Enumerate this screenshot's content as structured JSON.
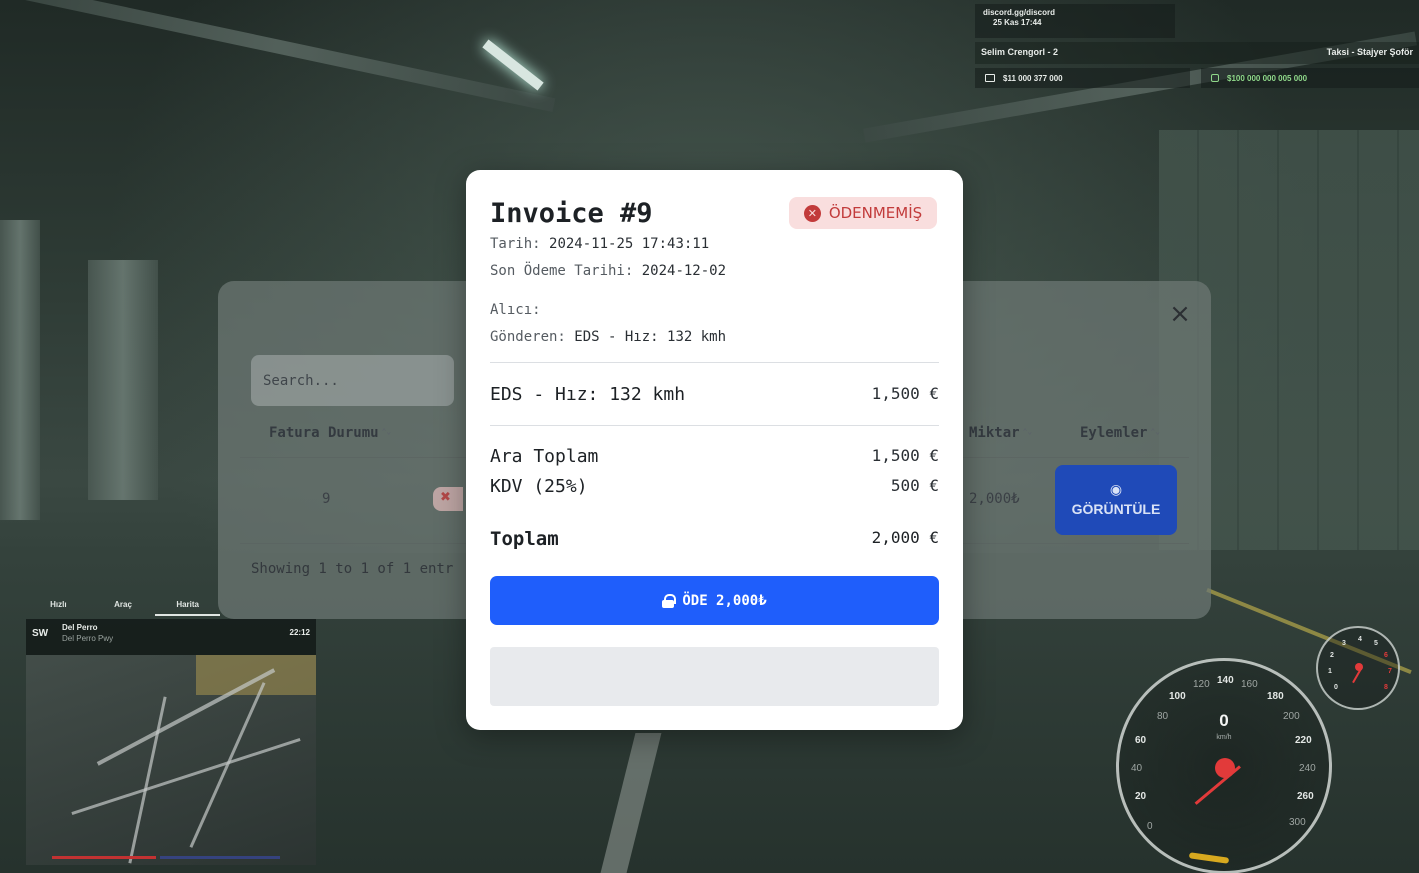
{
  "hud": {
    "discord_line1": "discord.gg/discord",
    "discord_line2": "25 Kas 17:44",
    "player_name": "Selim Crengorl - 2",
    "job": "Taksi - Stajyer Şoför",
    "cash": "$11 000 377 000",
    "bank": "$100 000 000 005 000"
  },
  "table_panel": {
    "close_icon": "×",
    "search_placeholder": "Search...",
    "headers": {
      "status": "Fatura Durumu",
      "amount": "Miktar",
      "actions": "Eylemler"
    },
    "sort_icon": "⌃⌄",
    "row": {
      "id": "9",
      "amount": "2,000₺",
      "view_label": "GÖRÜNTÜLE"
    },
    "footer_text": "Showing 1 to 1 of 1 entr"
  },
  "invoice": {
    "title": "Invoice #9",
    "status_badge": "ÖDENMEMİŞ",
    "date_label": "Tarih:",
    "date_value": "2024-11-25 17:43:11",
    "due_label": "Son Ödeme Tarihi:",
    "due_value": "2024-12-02",
    "recipient_label": "Alıcı:",
    "recipient_value": "",
    "sender_label": "Gönderen:",
    "sender_value": "EDS - Hız: 132 kmh",
    "items": [
      {
        "description": "EDS - Hız: 132 kmh",
        "amount": "1,500 €"
      }
    ],
    "subtotal_label": "Ara Toplam",
    "subtotal_value": "1,500 €",
    "tax_label": "KDV (25%)",
    "tax_value": "500 €",
    "total_label": "Toplam",
    "total_value": "2,000 €",
    "pay_button": "ÖDE 2,000₺"
  },
  "minimap": {
    "tabs": [
      "Hızlı",
      "Araç",
      "Harita"
    ],
    "direction": "SW",
    "street": "Del Perro",
    "sub_street": "Del Perro Pwy",
    "time": "22:12"
  },
  "speedometer": {
    "speed": "0",
    "unit": "km/h",
    "ticks": [
      "0",
      "20",
      "40",
      "60",
      "80",
      "100",
      "120",
      "140",
      "160",
      "180",
      "200",
      "220",
      "240",
      "260",
      "300"
    ]
  },
  "rpm_gauge": {
    "ticks": [
      "0",
      "1",
      "2",
      "3",
      "4",
      "5",
      "6",
      "7",
      "8"
    ]
  },
  "colors": {
    "accent_blue": "#1f5efb",
    "unpaid_red": "#c23b3b",
    "unpaid_bg": "#f9dede",
    "view_button": "#1f4ab8"
  }
}
